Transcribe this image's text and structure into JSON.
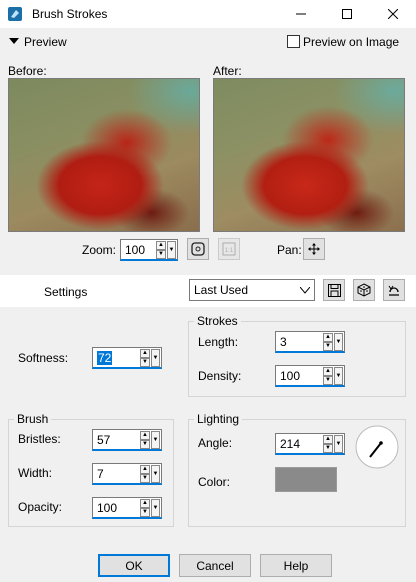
{
  "window": {
    "title": "Brush Strokes"
  },
  "preview": {
    "label": "Preview",
    "preview_on_image": "Preview on Image"
  },
  "images": {
    "before_label": "Before:",
    "after_label": "After:"
  },
  "zoom": {
    "label": "Zoom:",
    "value": "100"
  },
  "pan": {
    "label": "Pan:"
  },
  "settings": {
    "label": "Settings",
    "preset": "Last Used"
  },
  "softness": {
    "label": "Softness:",
    "value": "72"
  },
  "strokes": {
    "title": "Strokes",
    "length_label": "Length:",
    "length": "3",
    "density_label": "Density:",
    "density": "100"
  },
  "brush": {
    "title": "Brush",
    "bristles_label": "Bristles:",
    "bristles": "57",
    "width_label": "Width:",
    "width": "7",
    "opacity_label": "Opacity:",
    "opacity": "100"
  },
  "lighting": {
    "title": "Lighting",
    "angle_label": "Angle:",
    "angle": "214",
    "color_label": "Color:",
    "color_hex": "#8a8a8a"
  },
  "buttons": {
    "ok": "OK",
    "cancel": "Cancel",
    "help": "Help"
  },
  "colors": {
    "accent": "#0078d7",
    "window_bg": "#f0f0f0"
  }
}
